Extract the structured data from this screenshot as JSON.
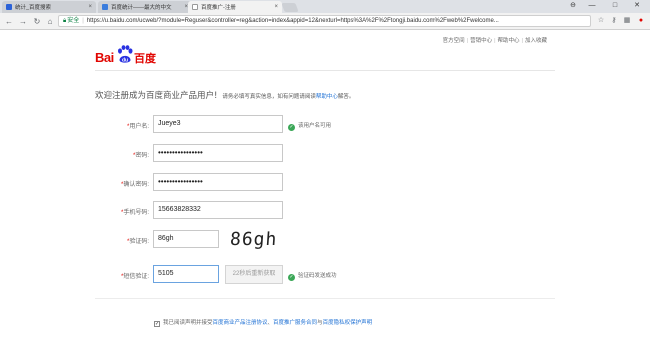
{
  "tabs": [
    {
      "title": "统计_百度搜索",
      "close": "×",
      "active": false
    },
    {
      "title": "百度统计——最大的中文",
      "close": "×",
      "active": false
    },
    {
      "title": "百度推广-注册",
      "close": "×",
      "active": true
    }
  ],
  "window_controls": {
    "user": "⊖",
    "minimize": "—",
    "maximize": "□",
    "close": "✕"
  },
  "address_bar": {
    "secure_label": "安全",
    "url": "https://u.baidu.com/ucweb/?module=Reguser&controller=reg&action=index&appid=12&nexturl=https%3A%2F%2Ftongji.baidu.com%2Fweb%2Fwelcome..."
  },
  "top_links": [
    "官方空间",
    "营销中心",
    "帮助中心",
    "加入收藏"
  ],
  "logo": {
    "text_left": "Bai",
    "paw_text": "du",
    "text_right": "百度"
  },
  "welcome": {
    "heading": "欢迎注册成为百度商业产品用户!",
    "sub": "请务必填写真实信息，如有问题请阅读",
    "help_link": "帮助中心",
    "sub_end": "解答。"
  },
  "form": {
    "username": {
      "label": "用户名:",
      "value": "Jueye3",
      "hint": "该用户名可用"
    },
    "password": {
      "label": "密码:",
      "value": "••••••••••••••••"
    },
    "confirm_password": {
      "label": "确认密码:",
      "value": "••••••••••••••••"
    },
    "phone": {
      "label": "手机号码:",
      "value": "15663828332"
    },
    "captcha": {
      "label": "验证码:",
      "value": "86gh",
      "image_text": "86gh"
    },
    "sms": {
      "label": "短信验证:",
      "value": "5105",
      "button": "22秒后重新获取",
      "hint": "验证码发送成功"
    }
  },
  "agreement": {
    "prefix": "我已阅读声明并接受",
    "link1": "百度商业产品注册协议",
    "sep1": "、",
    "link2": "百度推广服务合同",
    "sep2": "与",
    "link3": "百度隐私权保护声明"
  },
  "colors": {
    "brand_red": "#e10602",
    "link_blue": "#1c6fd4",
    "success_green": "#3aa757"
  }
}
